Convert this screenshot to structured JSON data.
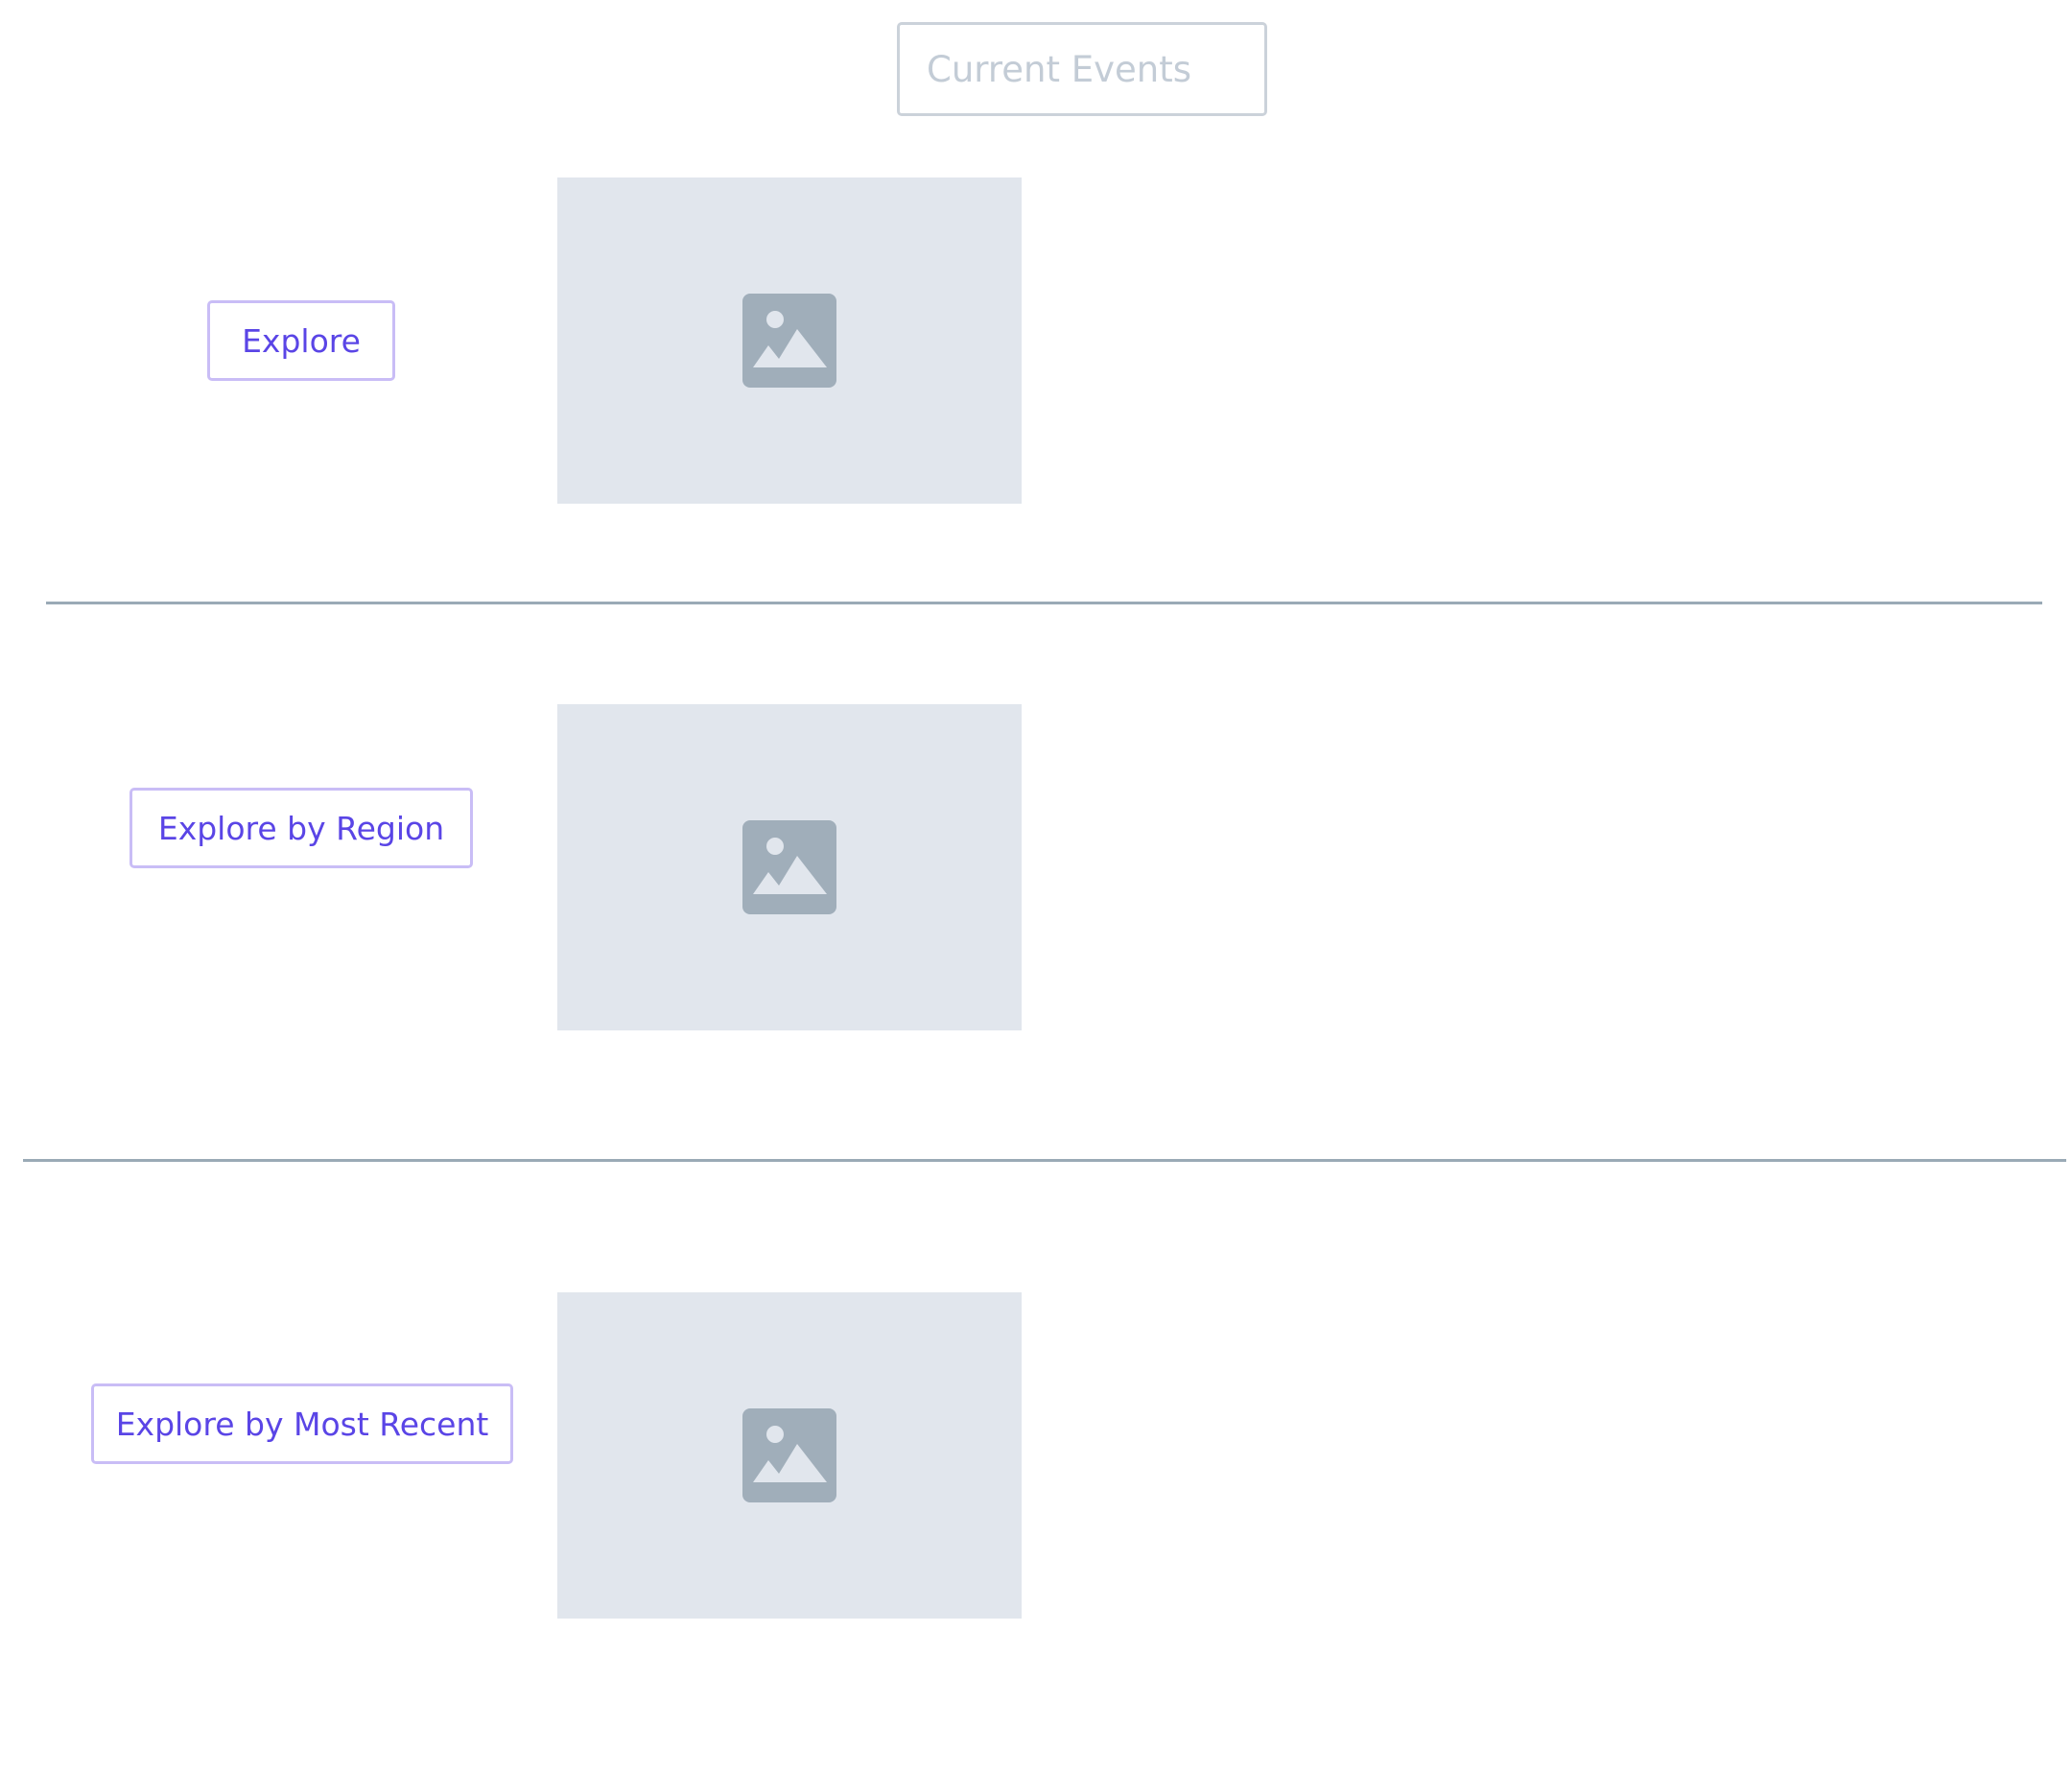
{
  "search": {
    "placeholder": "Current Events",
    "value": ""
  },
  "sections": [
    {
      "button_label": "Explore",
      "image_icon": "image-placeholder-icon"
    },
    {
      "button_label": "Explore by Region",
      "image_icon": "image-placeholder-icon"
    },
    {
      "button_label": "Explore by Most Recent",
      "image_icon": "image-placeholder-icon"
    }
  ],
  "colors": {
    "accent": "#5a45e6",
    "button_border": "#c9bdf6",
    "placeholder_bg": "#e1e6ed",
    "icon": "#a0aeba",
    "divider": "#9aaab6",
    "input_border": "#cbd2da",
    "input_placeholder": "#c3ccd6"
  }
}
